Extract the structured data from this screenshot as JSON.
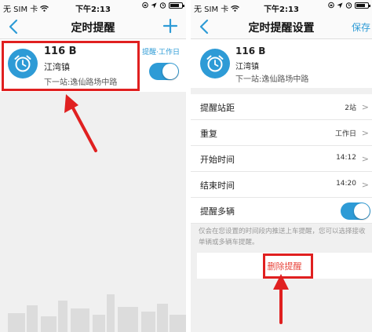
{
  "status": {
    "carrier": "无 SIM 卡",
    "time": "下午2:13",
    "battery_level": 0.75
  },
  "left_screen": {
    "title": "定时提醒",
    "card": {
      "route": "116 B",
      "stop": "江湾镇",
      "next_stop": "下一站:逸仙路场中路",
      "schedule_label": "提醒·工作日",
      "enabled": true
    }
  },
  "right_screen": {
    "title": "定时提醒设置",
    "save_label": "保存",
    "card": {
      "route": "116 B",
      "stop": "江湾镇",
      "next_stop": "下一站:逸仙路场中路"
    },
    "settings": [
      {
        "label": "提醒站距",
        "value": "2站"
      },
      {
        "label": "重复",
        "value": "工作日"
      },
      {
        "label": "开始时间",
        "value": "14:12"
      },
      {
        "label": "结束时间",
        "value": "14:20"
      },
      {
        "label": "提醒多辆",
        "value": ""
      }
    ],
    "multi_bus_enabled": true,
    "note": "仅会在您设置的时间段内推送上车提醒，您可以选择接收单辆或多辆车提醒。",
    "delete_label": "删除提醒"
  },
  "colors": {
    "accent": "#2e9bd6",
    "highlight": "#e02020",
    "delete_text": "#e8443a"
  }
}
